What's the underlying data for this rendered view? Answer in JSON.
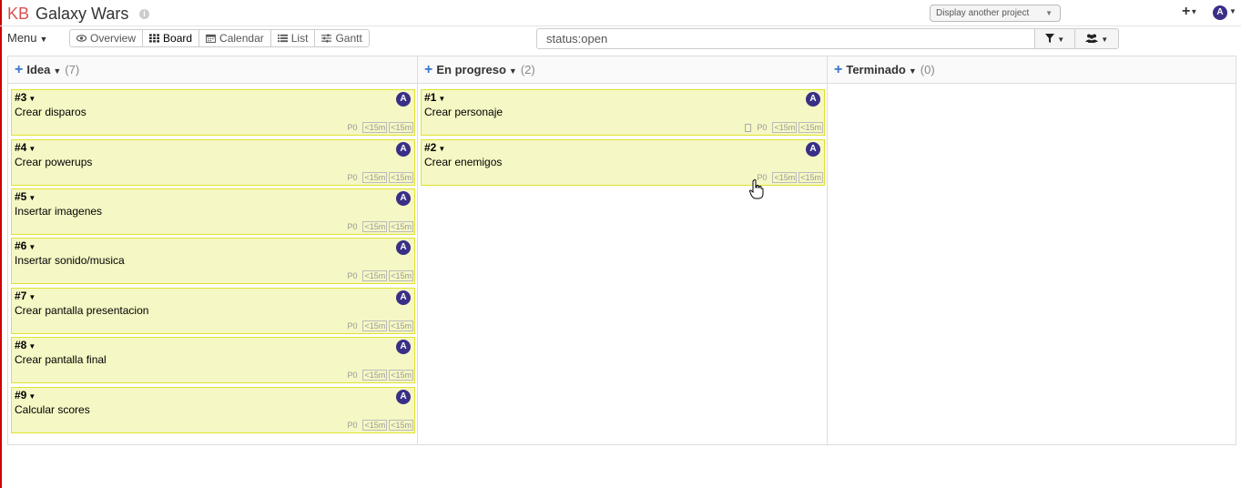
{
  "header": {
    "logo": "KB",
    "title": "Galaxy Wars",
    "project_select": "Display another project",
    "user_avatar": "A"
  },
  "toolbar": {
    "menu_label": "Menu",
    "views": [
      "Overview",
      "Board",
      "Calendar",
      "List",
      "Gantt"
    ],
    "active_view": "Board",
    "search_value": "status:open"
  },
  "columns": [
    {
      "title": "Idea",
      "count": "(7)"
    },
    {
      "title": "En progreso",
      "count": "(2)"
    },
    {
      "title": "Terminado",
      "count": "(0)"
    }
  ],
  "tasks": {
    "idea": [
      {
        "id": "#3",
        "name": "Crear disparos",
        "avatar": "A",
        "priority": "P0",
        "time1": "<15m",
        "time2": "<15m"
      },
      {
        "id": "#4",
        "name": "Crear powerups",
        "avatar": "A",
        "priority": "P0",
        "time1": "<15m",
        "time2": "<15m"
      },
      {
        "id": "#5",
        "name": "Insertar imagenes",
        "avatar": "A",
        "priority": "P0",
        "time1": "<15m",
        "time2": "<15m"
      },
      {
        "id": "#6",
        "name": "Insertar sonido/musica",
        "avatar": "A",
        "priority": "P0",
        "time1": "<15m",
        "time2": "<15m"
      },
      {
        "id": "#7",
        "name": "Crear pantalla presentacion",
        "avatar": "A",
        "priority": "P0",
        "time1": "<15m",
        "time2": "<15m"
      },
      {
        "id": "#8",
        "name": "Crear pantalla final",
        "avatar": "A",
        "priority": "P0",
        "time1": "<15m",
        "time2": "<15m"
      },
      {
        "id": "#9",
        "name": "Calcular scores",
        "avatar": "A",
        "priority": "P0",
        "time1": "<15m",
        "time2": "<15m"
      }
    ],
    "progress": [
      {
        "id": "#1",
        "name": "Crear personaje",
        "avatar": "A",
        "priority": "P0",
        "time1": "<15m",
        "time2": "<15m"
      },
      {
        "id": "#2",
        "name": "Crear enemigos",
        "avatar": "A",
        "priority": "P0",
        "time1": "<15m",
        "time2": "<15m"
      }
    ]
  },
  "colors": {
    "card_bg": "#f5f7c4",
    "card_border": "#dfe32d",
    "avatar": "#3a2f86",
    "accent": "#3a78c9",
    "logo": "#d9534f"
  }
}
